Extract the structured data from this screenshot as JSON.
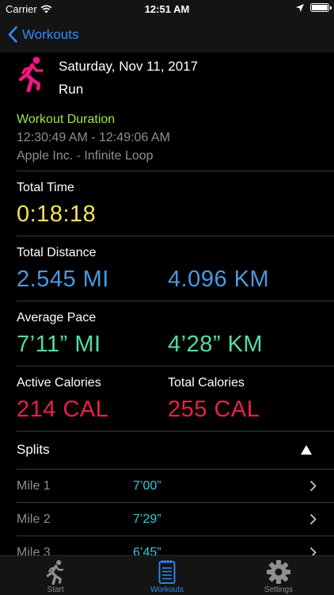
{
  "status": {
    "carrier": "Carrier",
    "time": "12:51 AM"
  },
  "nav": {
    "back_label": "Workouts"
  },
  "workout": {
    "date": "Saturday, Nov 11, 2017",
    "activity": "Run",
    "duration_label": "Workout Duration",
    "time_range": "12:30:49 AM - 12:49:06 AM",
    "location": "Apple Inc. - Infinite Loop"
  },
  "metrics": {
    "total_time": {
      "label": "Total Time",
      "value": "0:18:18"
    },
    "total_distance": {
      "label": "Total Distance",
      "value_mi": "2.545 MI",
      "value_km": "4.096 KM"
    },
    "average_pace": {
      "label": "Average Pace",
      "value_mi": "7’11” MI",
      "value_km": "4’28” KM"
    },
    "active_calories": {
      "label": "Active Calories",
      "value": "214 CAL"
    },
    "total_calories": {
      "label": "Total Calories",
      "value": "255 CAL"
    }
  },
  "splits": {
    "label": "Splits",
    "rows": [
      {
        "mile": "Mile 1",
        "pace": "7’00”"
      },
      {
        "mile": "Mile 2",
        "pace": "7’29”"
      },
      {
        "mile": "Mile 3",
        "pace": "6’45”"
      }
    ]
  },
  "tabs": [
    {
      "label": "Start",
      "icon": "runner-icon"
    },
    {
      "label": "Workouts",
      "icon": "notepad-icon",
      "active": true
    },
    {
      "label": "Settings",
      "icon": "gear-icon"
    }
  ],
  "colors": {
    "accent": "#2f8cf6",
    "workout_icon": "#f0167e",
    "duration_label": "#9ee54a",
    "time": "#f8e25c",
    "distance": "#4a98e0",
    "pace": "#56dba4",
    "calories": "#ec1f48",
    "split_pace": "#3bc8d9"
  }
}
